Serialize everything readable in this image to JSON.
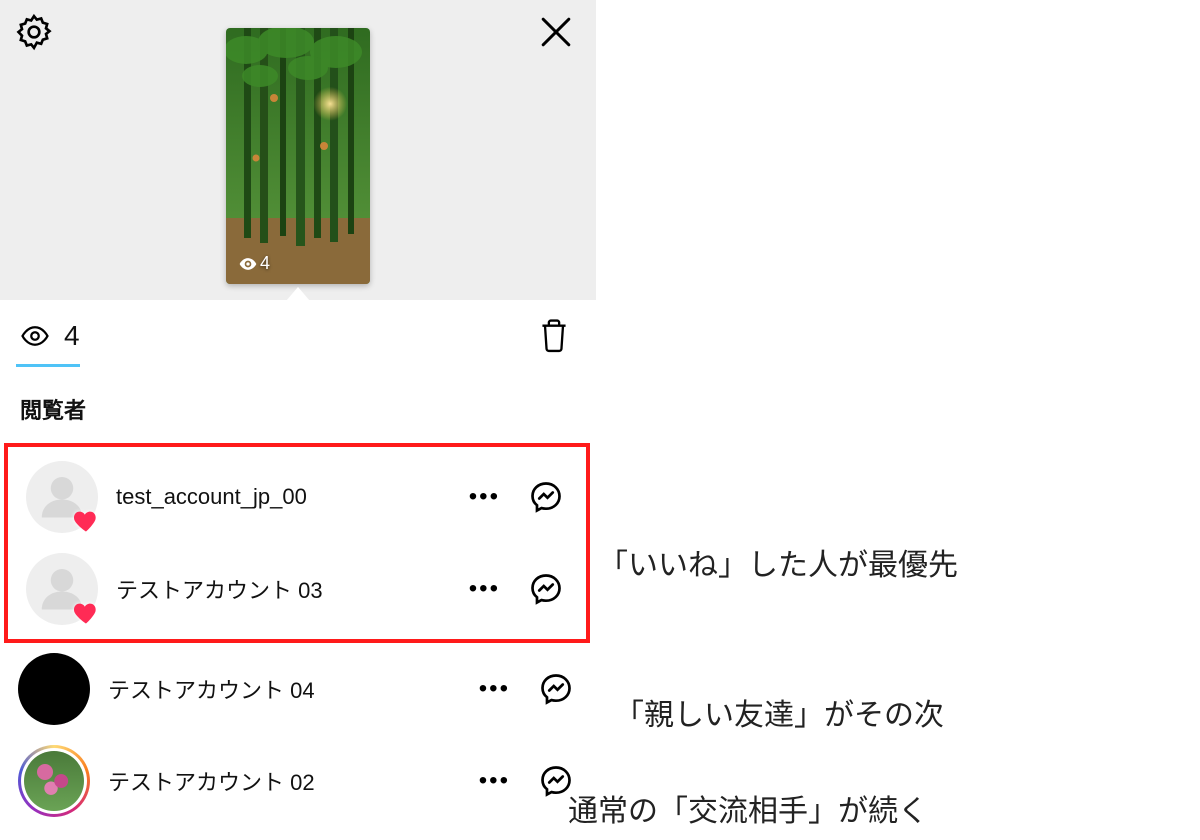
{
  "hero": {
    "views": "4"
  },
  "stats": {
    "views": "4"
  },
  "section_title": "閲覧者",
  "viewers": [
    {
      "name": "test_account_jp_00",
      "liked": true,
      "avatar": "placeholder"
    },
    {
      "name": "テストアカウント 03",
      "liked": true,
      "avatar": "placeholder"
    },
    {
      "name": "テストアカウント 04",
      "liked": false,
      "avatar": "dark"
    },
    {
      "name": "テストアカウント 02",
      "liked": false,
      "avatar": "storyring"
    }
  ],
  "annotations": {
    "a1": "「いいね」した人が最優先",
    "a2": "「親しい友達」がその次",
    "a3": "通常の「交流相手」が続く"
  }
}
